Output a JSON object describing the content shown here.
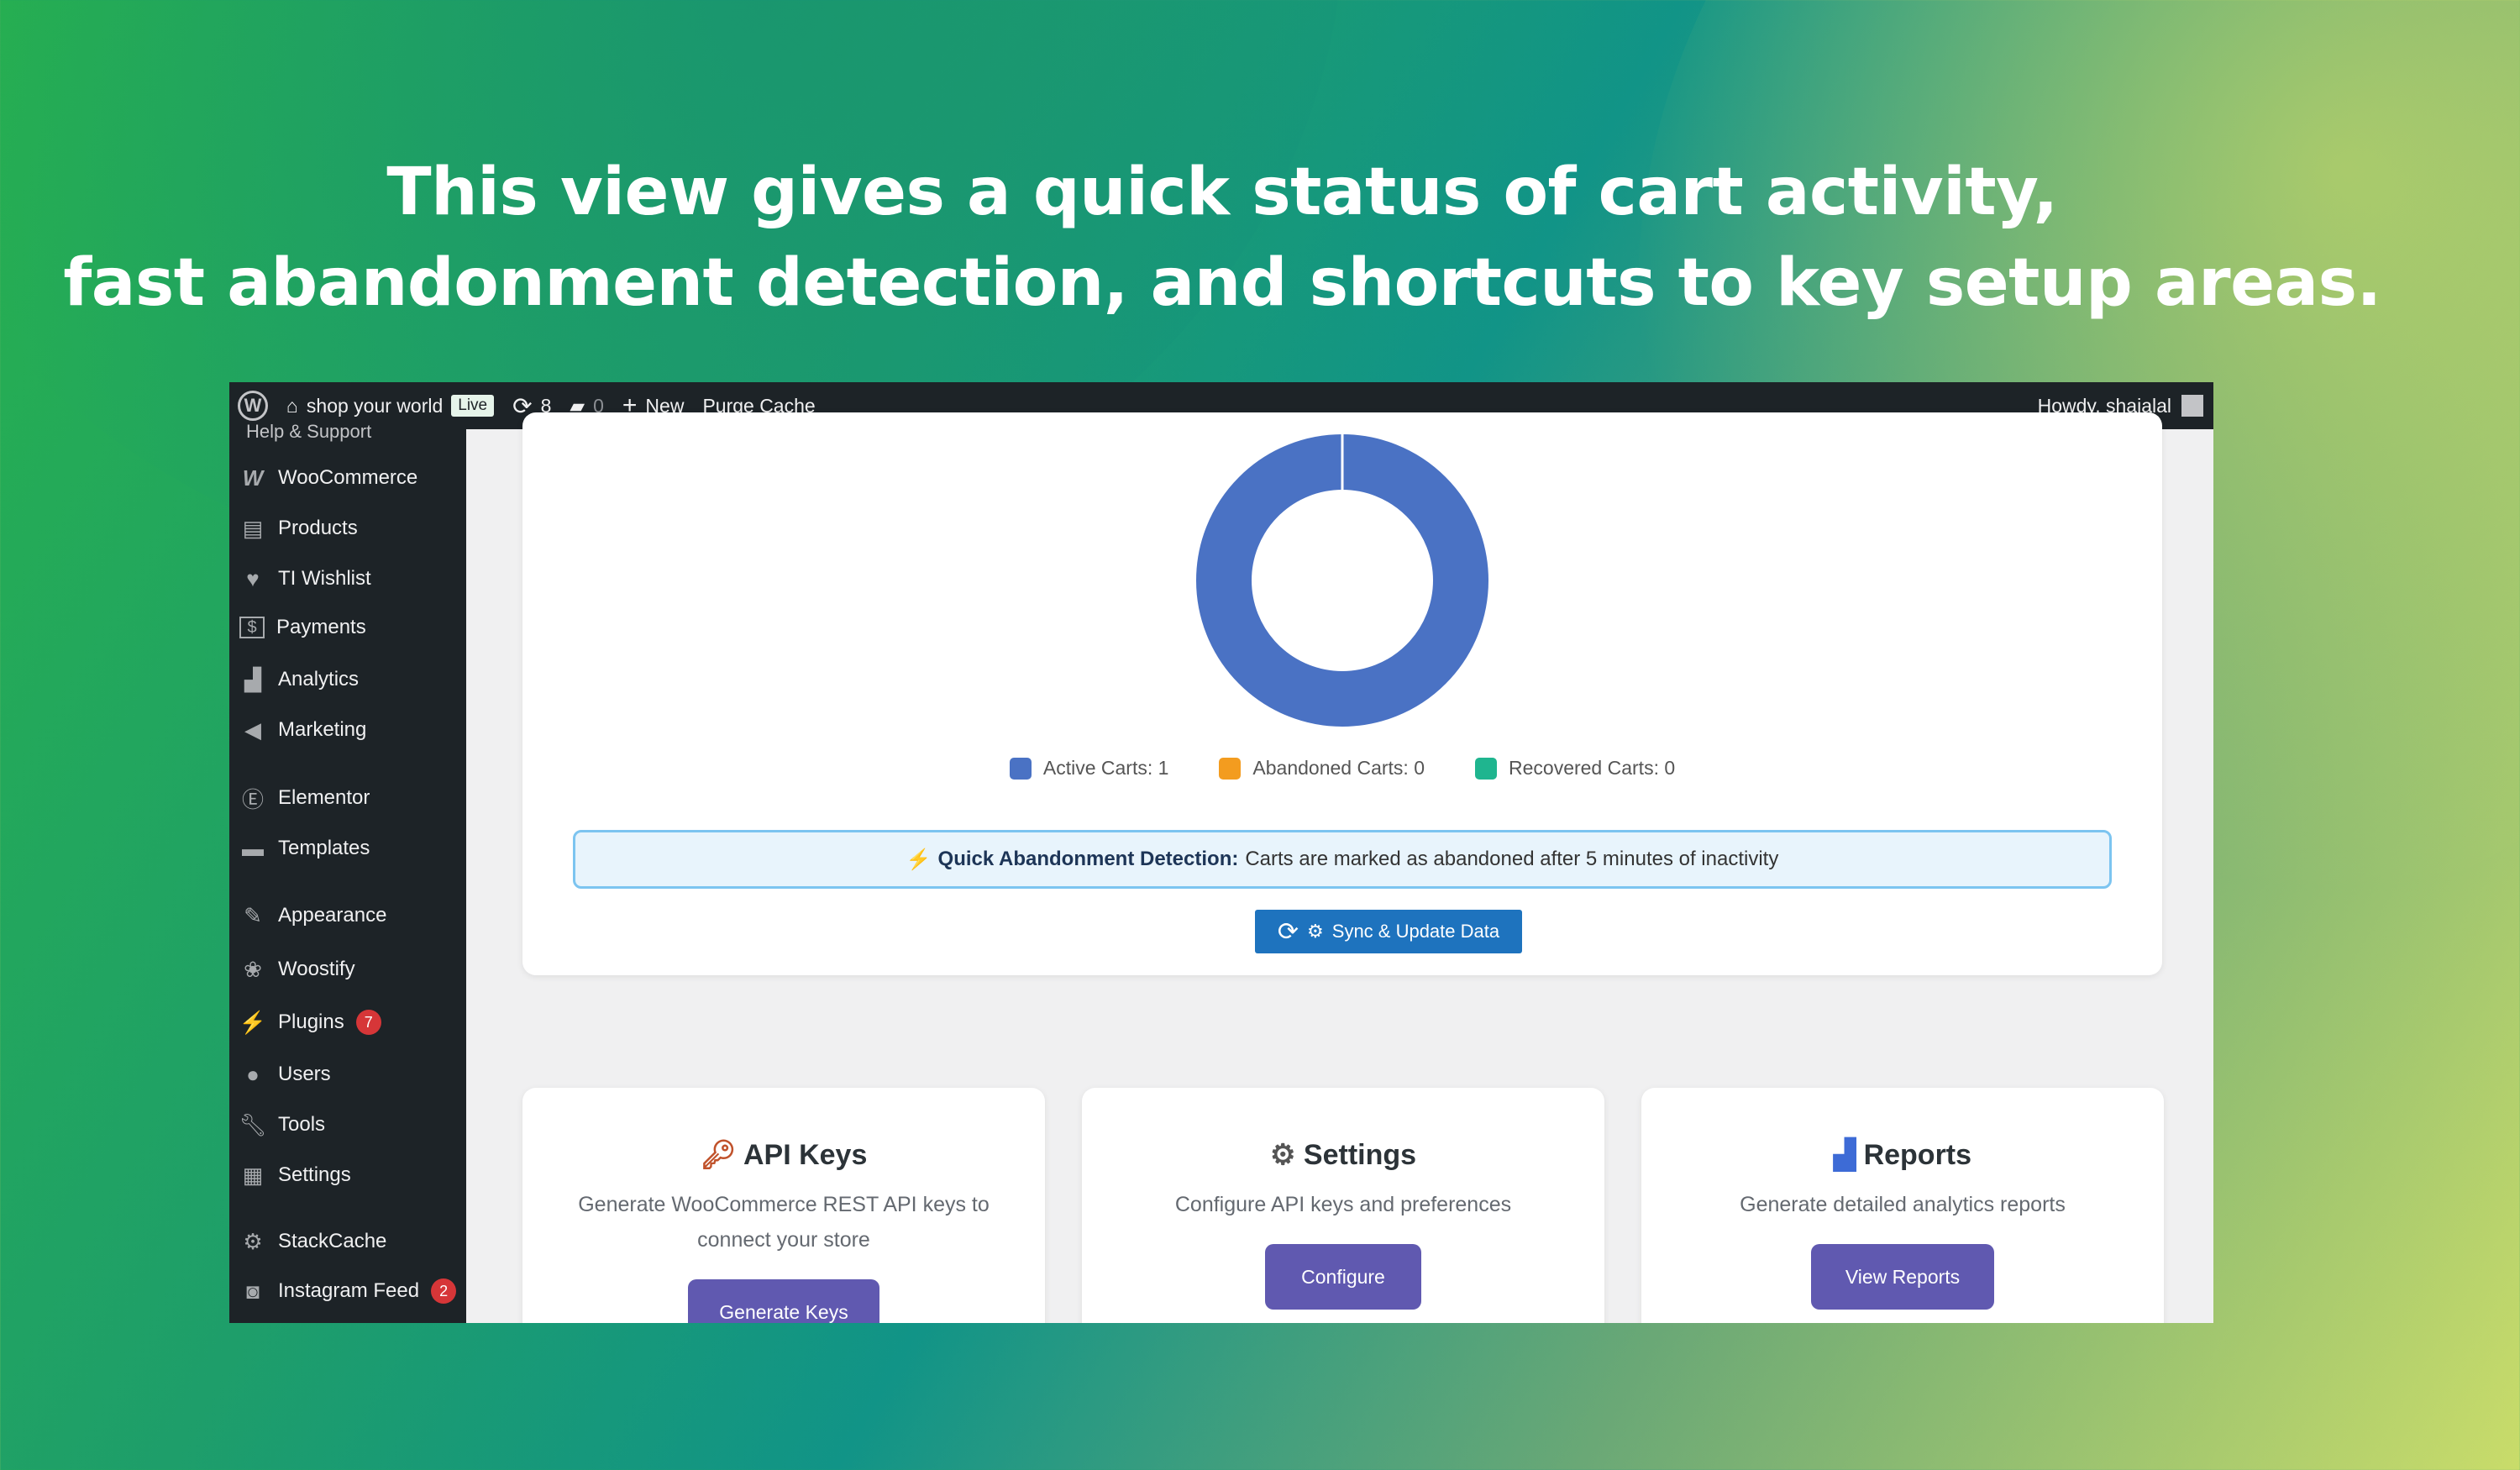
{
  "headline": {
    "line1": "This view gives a quick status of cart activity,",
    "line2": "fast abandonment detection, and shortcuts to key setup areas."
  },
  "adminbar": {
    "site_name": "shop your world",
    "live_badge": "Live",
    "updates_count": "8",
    "comments_count": "0",
    "new_label": "New",
    "purge_label": "Purge Cache",
    "greeting": "Howdy, shajalal"
  },
  "sidebar": {
    "partial_top": "Help & Support",
    "items": [
      {
        "label": "WooCommerce",
        "icon": "woocommerce-icon"
      },
      {
        "label": "Products",
        "icon": "archive-icon"
      },
      {
        "label": "TI Wishlist",
        "icon": "heart-icon"
      },
      {
        "label": "Payments",
        "icon": "dollar-icon"
      },
      {
        "label": "Analytics",
        "icon": "bar-chart-icon"
      },
      {
        "label": "Marketing",
        "icon": "megaphone-icon"
      },
      {
        "label": "Elementor",
        "icon": "elementor-icon"
      },
      {
        "label": "Templates",
        "icon": "folder-icon"
      },
      {
        "label": "Appearance",
        "icon": "paintbrush-icon"
      },
      {
        "label": "Woostify",
        "icon": "woostify-icon"
      },
      {
        "label": "Plugins",
        "icon": "plugin-icon",
        "badge": "7"
      },
      {
        "label": "Users",
        "icon": "user-icon"
      },
      {
        "label": "Tools",
        "icon": "wrench-icon"
      },
      {
        "label": "Settings",
        "icon": "sliders-icon"
      },
      {
        "label": "StackCache",
        "icon": "gear-icon"
      },
      {
        "label": "Instagram Feed",
        "icon": "instagram-icon",
        "badge": "2"
      }
    ]
  },
  "chart_data": {
    "type": "pie",
    "categories": [
      "Active Carts",
      "Abandoned Carts",
      "Recovered Carts"
    ],
    "values": [
      1,
      0,
      0
    ],
    "colors": [
      "#4a72c4",
      "#f39c1f",
      "#1fb58f"
    ]
  },
  "legend": {
    "active": "Active Carts: 1",
    "abandoned": "Abandoned Carts: 0",
    "recovered": "Recovered Carts: 0"
  },
  "detection": {
    "label": "Quick Abandonment Detection:",
    "text": "Carts are marked as abandoned after 5 minutes of inactivity"
  },
  "sync_button": "Sync & Update Data",
  "cards": {
    "api": {
      "title": "API Keys",
      "desc": "Generate WooCommerce REST API keys to connect your store",
      "button": "Generate Keys"
    },
    "settings": {
      "title": "Settings",
      "desc": "Configure API keys and preferences",
      "button": "Configure"
    },
    "reports": {
      "title": "Reports",
      "desc": "Generate detailed analytics reports",
      "button": "View Reports"
    }
  },
  "colors": {
    "accent_button": "#6059b0",
    "sync_button": "#1e73be",
    "adminbar": "#1d2327"
  }
}
